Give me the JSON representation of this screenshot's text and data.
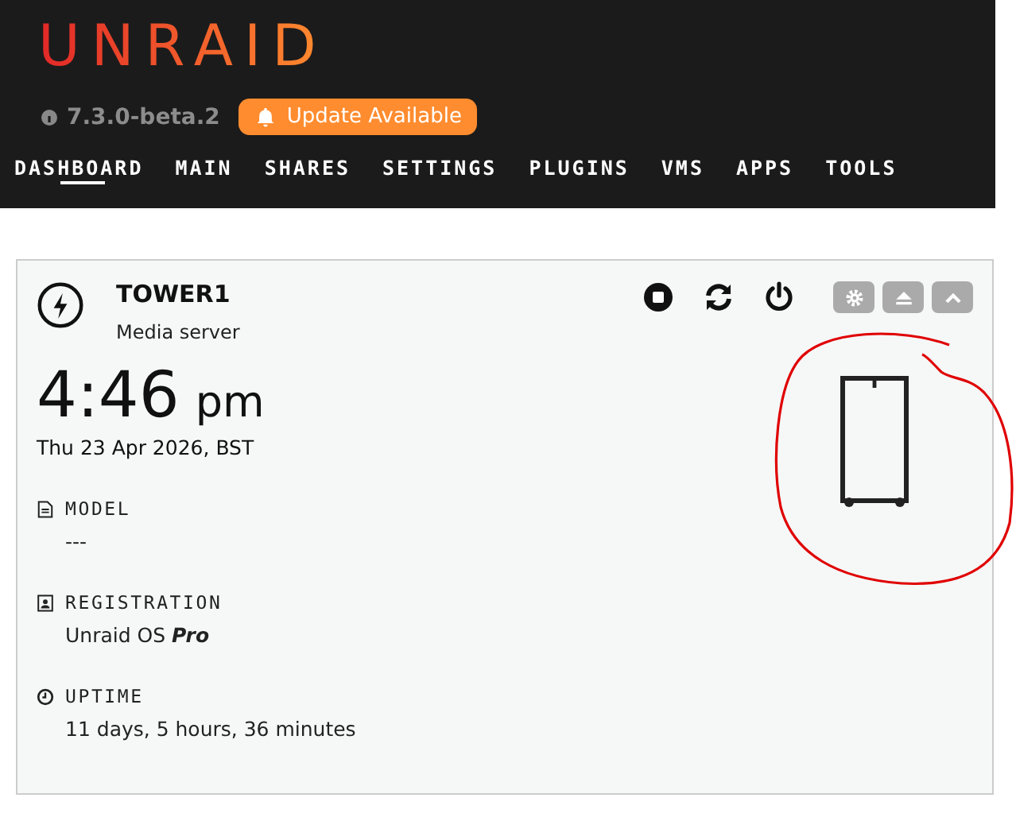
{
  "header": {
    "logo": "UNRAID",
    "version": "7.3.0-beta.2",
    "update_button": "Update Available"
  },
  "nav": [
    {
      "label": "DASHBOARD",
      "selected": true
    },
    {
      "label": "MAIN",
      "selected": false
    },
    {
      "label": "SHARES",
      "selected": false
    },
    {
      "label": "SETTINGS",
      "selected": false
    },
    {
      "label": "PLUGINS",
      "selected": false
    },
    {
      "label": "VMS",
      "selected": false
    },
    {
      "label": "APPS",
      "selected": false
    },
    {
      "label": "TOOLS",
      "selected": false
    }
  ],
  "card": {
    "server_name": "TOWER1",
    "description": "Media server",
    "time": "4:46",
    "meridiem": "pm",
    "date": "Thu 23 Apr 2026, BST",
    "fields": [
      {
        "kind": "model",
        "label": "MODEL",
        "value": "---"
      },
      {
        "kind": "registration",
        "label": "REGISTRATION",
        "value": "Unraid OS **Pro**"
      },
      {
        "kind": "uptime",
        "label": "UPTIME",
        "value": "11 days, 5 hours, 36 minutes"
      }
    ]
  },
  "annotation": {
    "kind": "circle"
  }
}
